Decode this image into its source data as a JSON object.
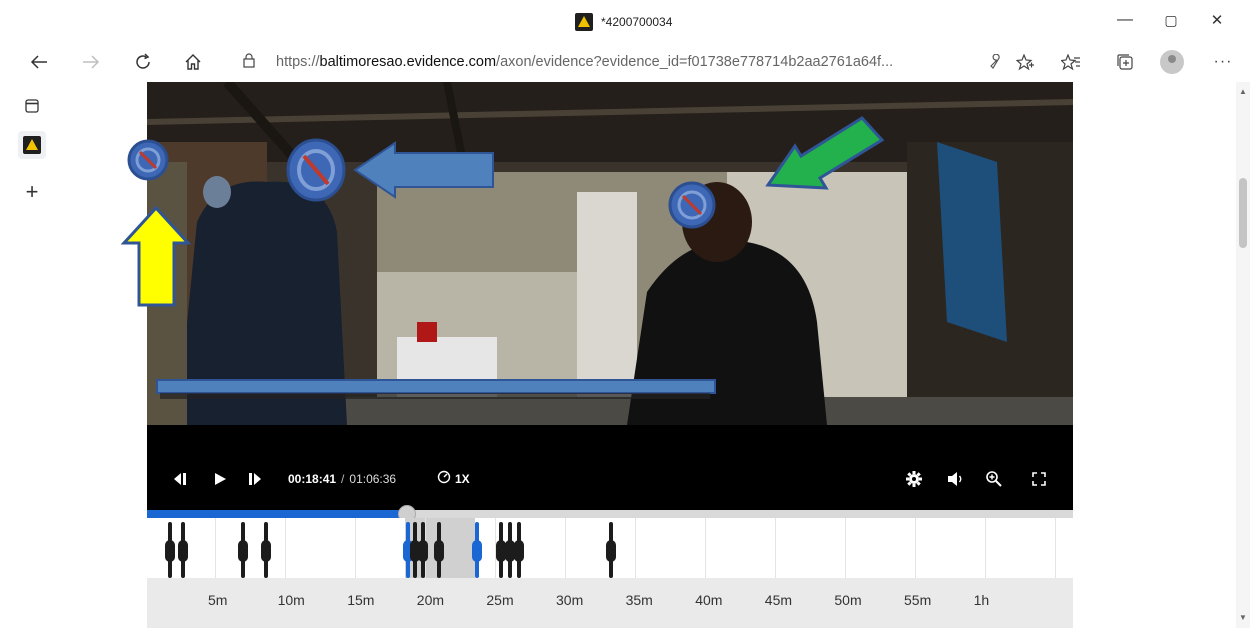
{
  "window": {
    "title": "*4200700034",
    "app_icon": "axon-warning-icon",
    "controls": {
      "minimize": "—",
      "maximize": "▢",
      "close": "✕"
    }
  },
  "browser": {
    "url_host": "baltimoresao.evidence.com",
    "url_scheme": "https://",
    "url_path": "/axon/evidence?evidence_id=f01738e778714b2aa2761a64f...",
    "icons": [
      "back-icon",
      "forward-icon",
      "refresh-icon",
      "home-icon",
      "page-info-icon",
      "read-aloud-icon",
      "favorite-add-icon",
      "favorites-icon",
      "collections-icon",
      "profile-icon",
      "more-icon"
    ]
  },
  "sidebar": {
    "items": [
      {
        "icon": "tab-actions-icon"
      },
      {
        "icon": "axon-tab-icon"
      },
      {
        "icon": "new-tab-icon"
      }
    ]
  },
  "player": {
    "time_current": "00:18:41",
    "time_separator": "/",
    "time_total": "01:06:36",
    "speed": "1X",
    "playhead_position": 0.281,
    "icons": [
      "previous-frame-icon",
      "play-icon",
      "next-frame-icon",
      "speed-icon",
      "settings-icon",
      "volume-icon",
      "zoom-in-icon",
      "fullscreen-icon"
    ]
  },
  "timeline": {
    "ticks": [
      "5m",
      "10m",
      "15m",
      "20m",
      "25m",
      "30m",
      "35m",
      "40m",
      "45m",
      "50m",
      "55m",
      "1h"
    ]
  },
  "colors": {
    "accent_blue": "#1a66d2",
    "annotation_blue": "#4f81bd",
    "annotation_green": "#22b14c",
    "annotation_yellow": "#ffff00"
  }
}
